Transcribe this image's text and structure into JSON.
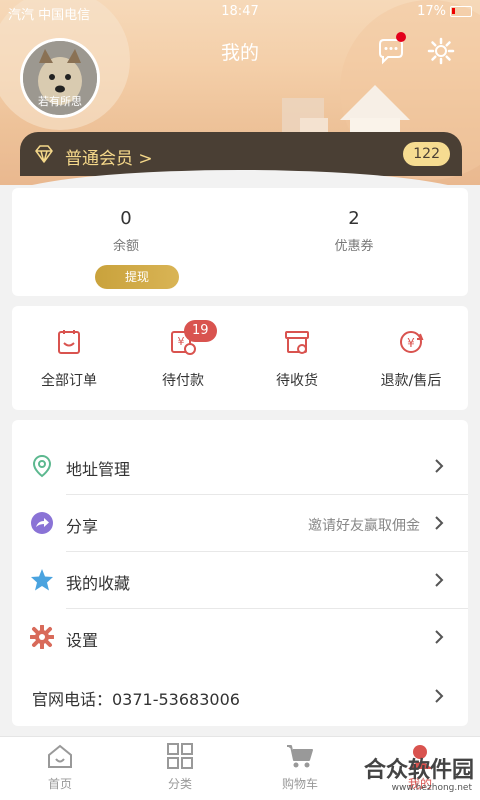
{
  "status_bar": {
    "carrier": "汽汽 中国电信",
    "time": "18:47",
    "battery": "17%"
  },
  "header": {
    "title": "我的",
    "username": "若有所思",
    "member_label": "普通会员 >",
    "member_points": "122"
  },
  "balance": {
    "balance_value": "0",
    "balance_label": "余额",
    "coupon_value": "2",
    "coupon_label": "优惠券",
    "withdraw_label": "提现"
  },
  "orders": {
    "items": [
      {
        "label": "全部订单",
        "icon": "all-orders-icon"
      },
      {
        "label": "待付款",
        "icon": "pending-payment-icon",
        "badge": "19"
      },
      {
        "label": "待收货",
        "icon": "pending-delivery-icon"
      },
      {
        "label": "退款/售后",
        "icon": "refund-icon"
      }
    ]
  },
  "menu": {
    "address": "地址管理",
    "share": "分享",
    "share_hint": "邀请好友赢取佣金",
    "favorites": "我的收藏",
    "settings": "设置",
    "phone": "官网电话：0371-53683006"
  },
  "tabs": [
    {
      "label": "首页",
      "icon": "home-icon"
    },
    {
      "label": "分类",
      "icon": "category-icon"
    },
    {
      "label": "购物车",
      "icon": "cart-icon"
    },
    {
      "label": "我的",
      "icon": "profile-icon"
    }
  ],
  "watermark": {
    "text": "合众软件园",
    "url": "www.hezhong.net"
  },
  "colors": {
    "accent": "#d9534f",
    "gold": "#f5d88a",
    "member_bar": "#4a3f34"
  }
}
